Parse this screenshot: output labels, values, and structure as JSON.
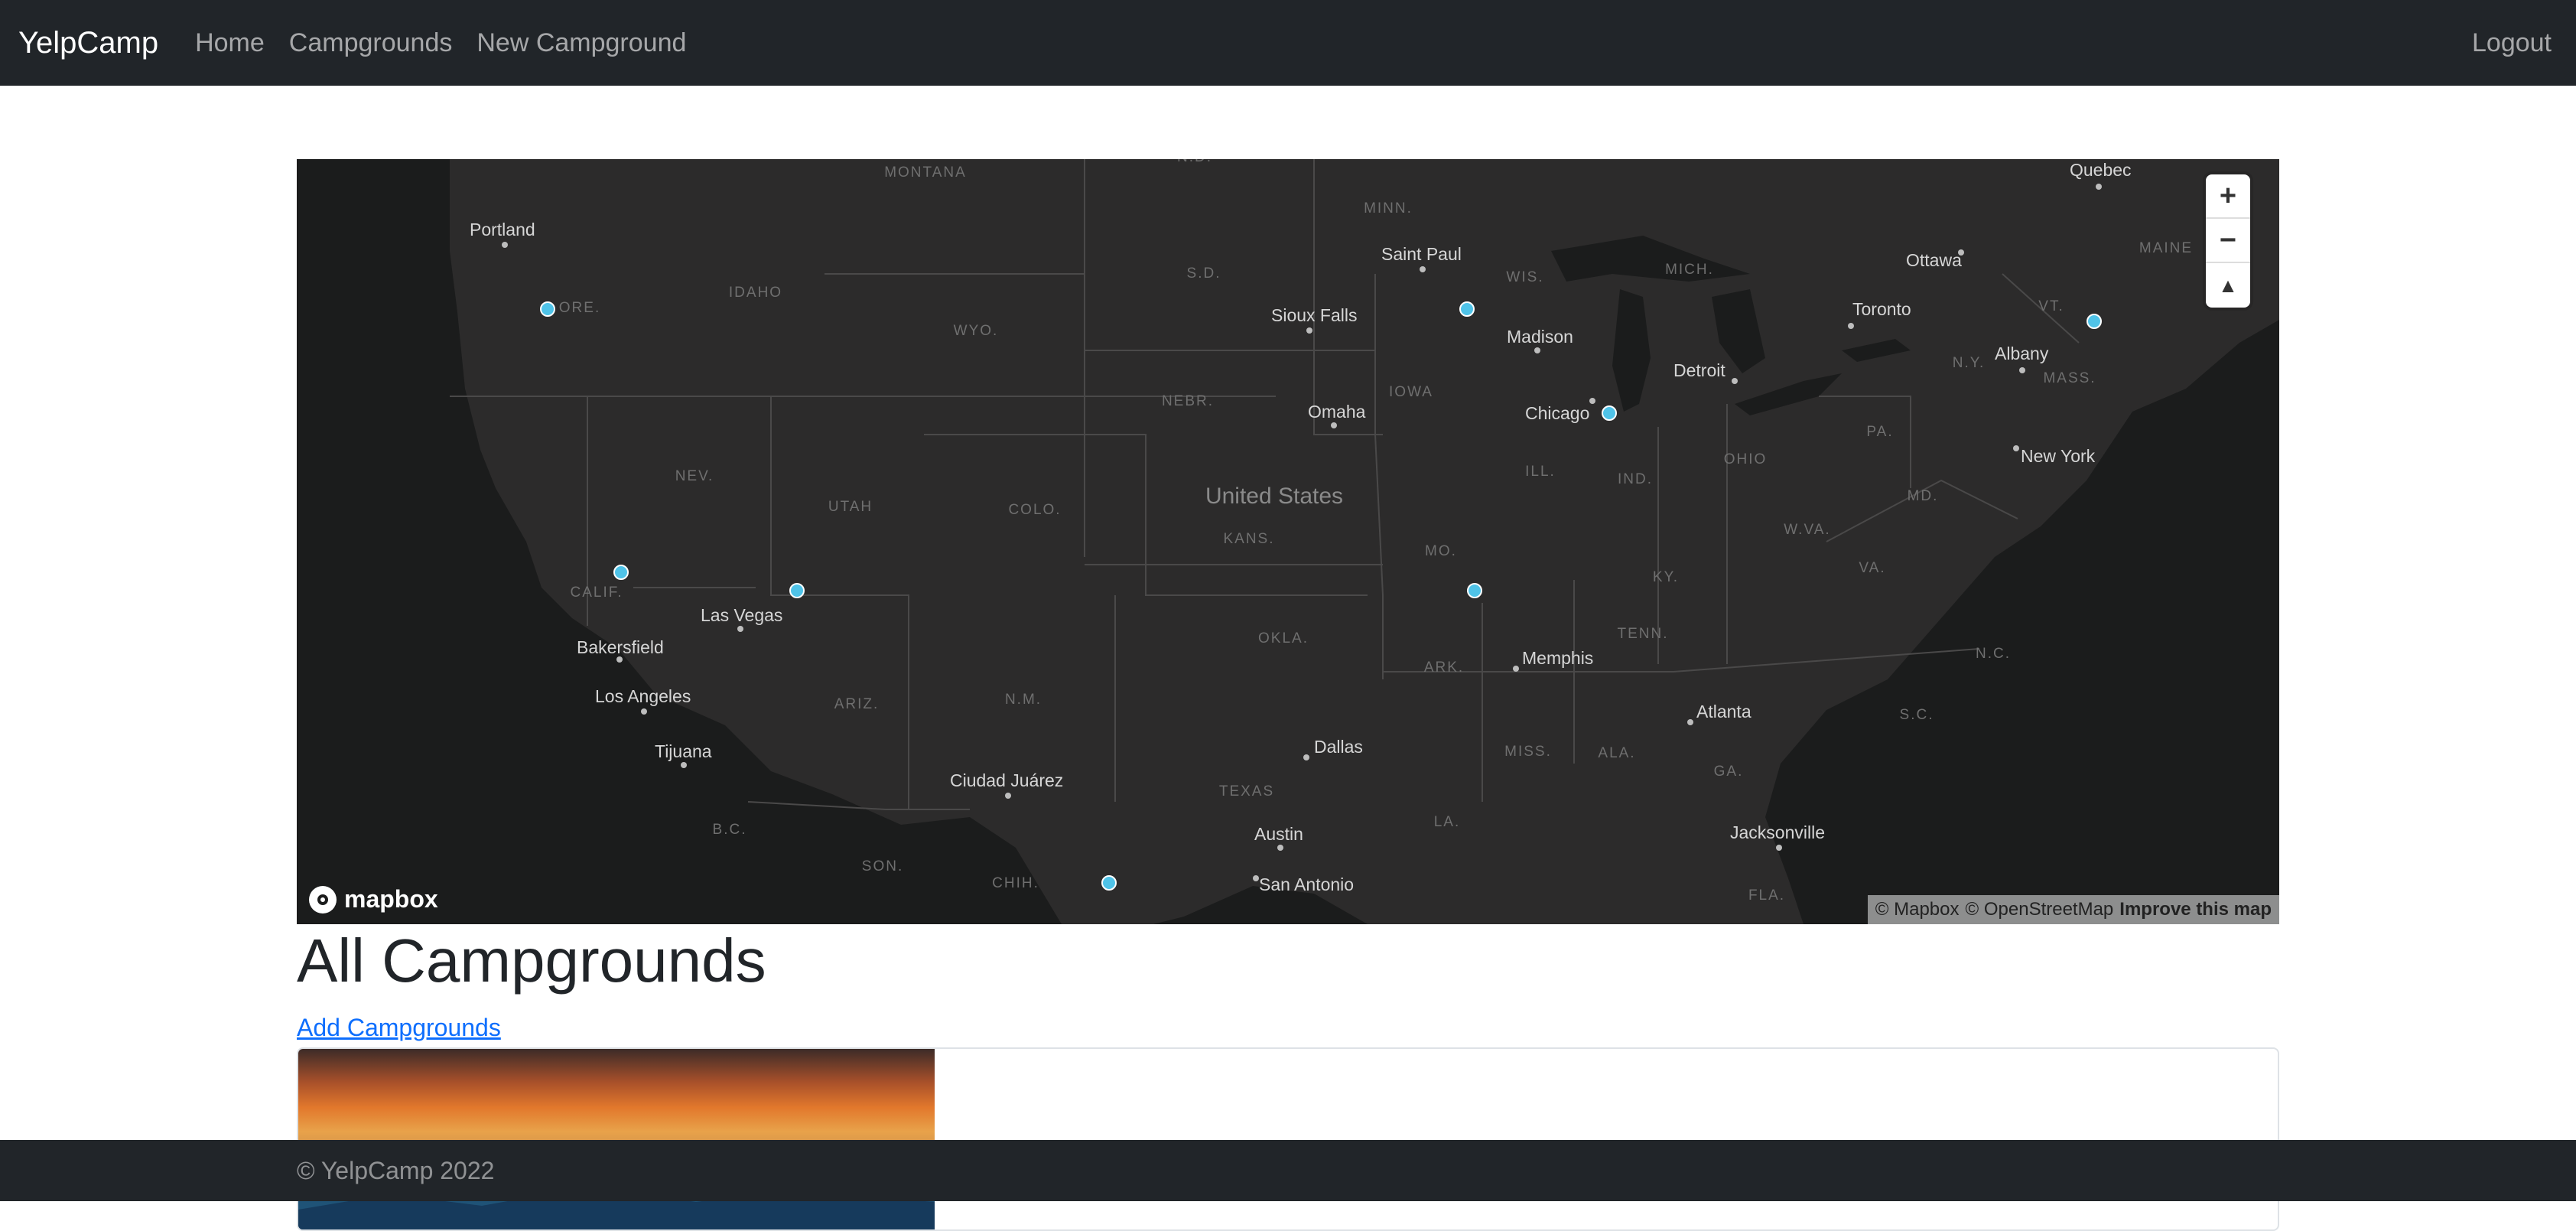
{
  "navbar": {
    "brand": "YelpCamp",
    "links": [
      "Home",
      "Campgrounds",
      "New Campground"
    ],
    "logout": "Logout"
  },
  "map": {
    "controls": {
      "zoom_in": "+",
      "zoom_out": "−",
      "compass": "▲"
    },
    "logo": "mapbox",
    "attribution": [
      "© Mapbox",
      "© OpenStreetMap"
    ],
    "improve": "Improve this map",
    "country_label": "United States",
    "state_labels": [
      "MONTANA",
      "IDAHO",
      "WYO.",
      "S.D.",
      "MINN.",
      "WIS.",
      "MICH.",
      "NEBR.",
      "IOWA",
      "UTAH",
      "COLO.",
      "NEV.",
      "KANS.",
      "MO.",
      "ILL.",
      "IND.",
      "OHIO",
      "PA.",
      "N.Y.",
      "MASS.",
      "ARIZ.",
      "N.M.",
      "OKLA.",
      "ARK.",
      "TENN.",
      "KY.",
      "W.VA.",
      "VA.",
      "MD.",
      "N.C.",
      "S.C.",
      "GA.",
      "ALA.",
      "MISS.",
      "LA.",
      "TEXAS",
      "FLA.",
      "CALIF.",
      "ORE.",
      "B.C.",
      "SON.",
      "CHIH.",
      "N.D.",
      "MAINE",
      "VT."
    ],
    "city_labels": [
      "Portland",
      "Saint Paul",
      "Sioux Falls",
      "Madison",
      "Detroit",
      "Chicago",
      "Omaha",
      "Ottawa",
      "Toronto",
      "Albany",
      "Quebec",
      "New York",
      "Las Vegas",
      "Bakersfield",
      "Los Angeles",
      "Tijuana",
      "Ciudad Juárez",
      "Memphis",
      "Atlanta",
      "Dallas",
      "Austin",
      "San Antonio",
      "Jacksonville"
    ],
    "marker_color": "#4fc3e8"
  },
  "main": {
    "title": "All Campgrounds",
    "add_link": "Add Campgrounds"
  },
  "footer": {
    "text": "© YelpCamp 2022"
  }
}
